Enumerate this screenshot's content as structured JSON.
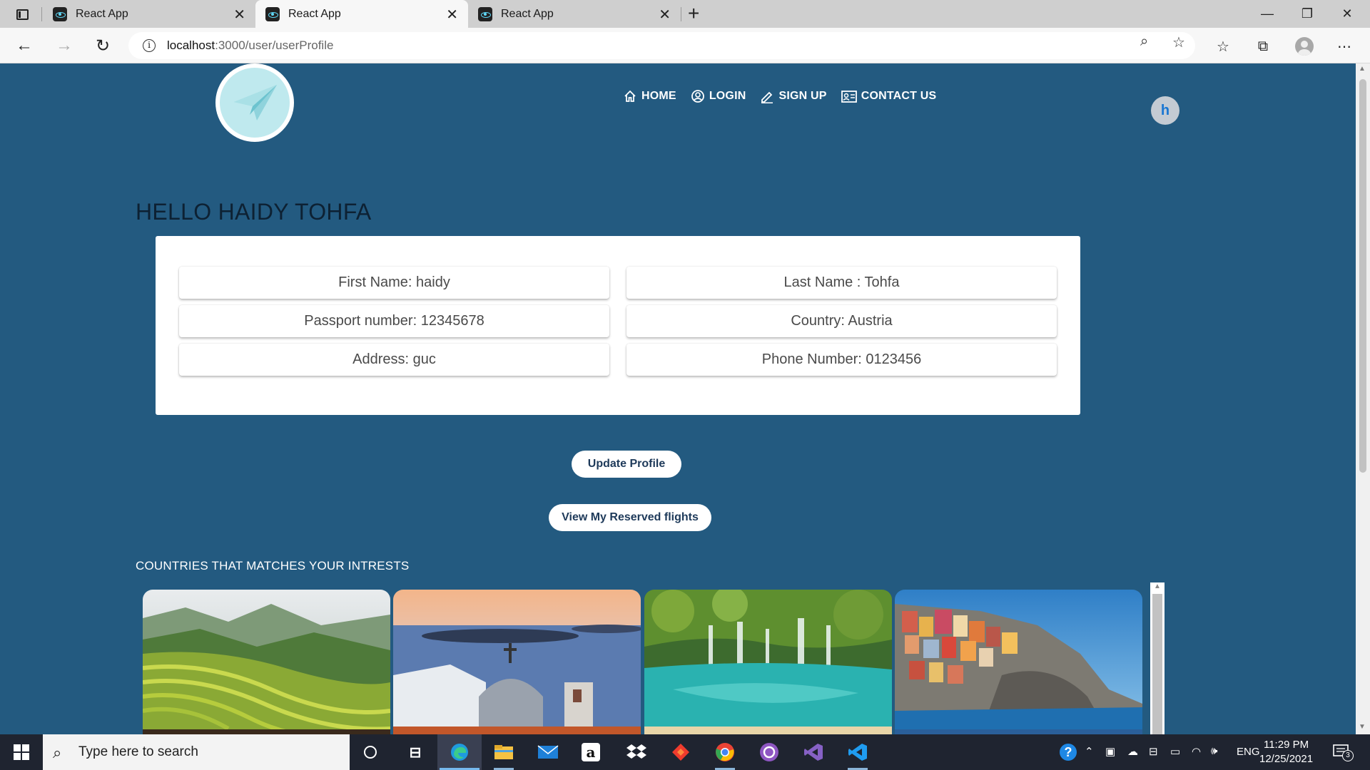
{
  "browser": {
    "tabs": [
      {
        "title": "React App",
        "active": false
      },
      {
        "title": "React App",
        "active": true
      },
      {
        "title": "React App",
        "active": false
      }
    ],
    "url_host": "localhost",
    "url_path": ":3000/user/userProfile"
  },
  "header": {
    "nav": [
      {
        "label": "HOME",
        "icon": "home-icon"
      },
      {
        "label": "LOGIN",
        "icon": "account-circle-icon"
      },
      {
        "label": "SIGN UP",
        "icon": "pencil-icon"
      },
      {
        "label": "CONTACT US",
        "icon": "contact-card-icon"
      }
    ],
    "avatar_letter": "h"
  },
  "profile": {
    "greeting": "HELLO HAIDY TOHFA",
    "first_name": "First Name: haidy",
    "last_name": "Last Name : Tohfa",
    "passport": "Passport number: 12345678",
    "country": "Country: Austria",
    "address": "Address: guc",
    "phone": "Phone Number: 0123456"
  },
  "actions": {
    "update_label": "Update Profile",
    "reserved_label": "View My Reserved flights"
  },
  "countries": {
    "title": "COUNTRIES THAT MATCHES YOUR INTRESTS",
    "images": [
      "rice-terraces-photo",
      "santorini-photo",
      "waterfall-lake-photo",
      "cinque-terre-photo"
    ]
  },
  "taskbar": {
    "search_placeholder": "Type here to search",
    "language": "ENG",
    "time": "11:29 PM",
    "date": "12/25/2021",
    "notifications": "3"
  },
  "colors": {
    "page_bg": "#235a80",
    "accent": "#1976d2"
  }
}
